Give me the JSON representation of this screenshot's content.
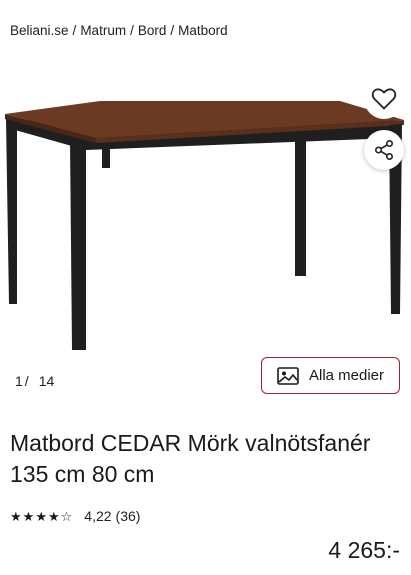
{
  "breadcrumb": {
    "items": [
      "Beliani.se",
      "Matrum",
      "Bord",
      "Matbord"
    ],
    "separator": "/"
  },
  "gallery": {
    "current": "1",
    "separator": "/",
    "total": "14",
    "media_button_label": "Alla medier",
    "favorite_icon": "heart-icon",
    "share_icon": "share-icon"
  },
  "product": {
    "title": "Matbord CEDAR Mörk valnötsfanér 135 cm 80 cm",
    "rating_value": "4,22",
    "rating_count": "(36)",
    "stars_filled": 4,
    "stars_total": 5,
    "price": "4 265:-"
  },
  "colors": {
    "accent": "#9b2335",
    "tabletop": "#6b3a22",
    "legs": "#1f1f1f"
  }
}
